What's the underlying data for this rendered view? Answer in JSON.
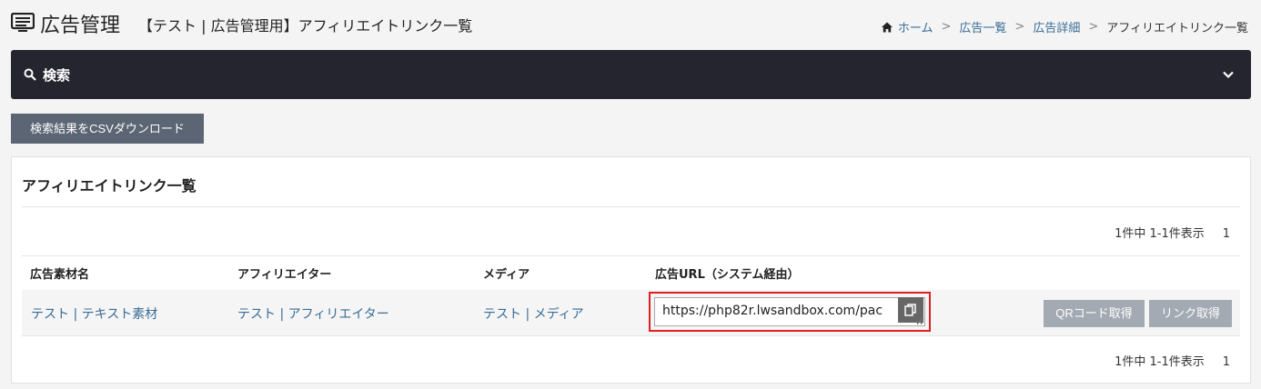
{
  "header": {
    "title": "広告管理",
    "subtitle": "【テスト | 広告管理用】アフィリエイトリンク一覧",
    "icon": "list-icon"
  },
  "breadcrumb": {
    "home": "ホーム",
    "items": [
      "広告一覧",
      "広告詳細"
    ],
    "current": "アフィリエイトリンク一覧",
    "separator": ">"
  },
  "search": {
    "label": "検索"
  },
  "csv_button": "検索結果をCSVダウンロード",
  "card": {
    "title": "アフィリエイトリンク一覧",
    "paging_text": "1件中 1-1件表示",
    "page": "1"
  },
  "table": {
    "columns": [
      "広告素材名",
      "アフィリエイター",
      "メディア",
      "広告URL（システム経由）"
    ],
    "rows": [
      {
        "material": "テスト | テキスト素材",
        "affiliator": "テスト | アフィリエイター",
        "media": "テスト | メディア",
        "url": "https://php82r.lwsandbox.com/pac",
        "qr_button": "QRコード取得",
        "link_button": "リンク取得"
      }
    ]
  },
  "colors": {
    "dark_bar": "#25252f",
    "link": "#3a6d96",
    "highlight": "#e02020"
  }
}
